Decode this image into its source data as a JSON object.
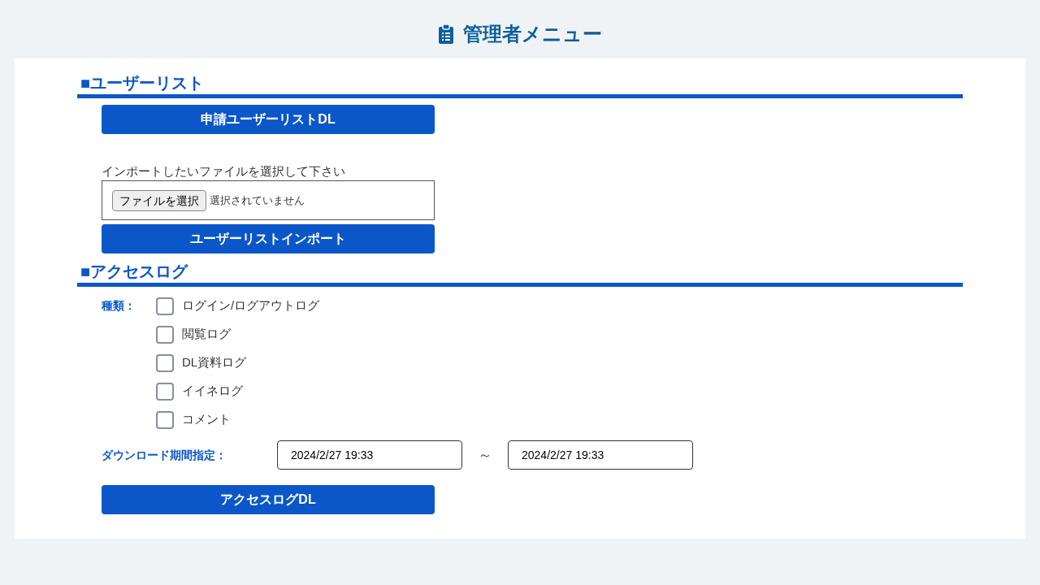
{
  "page": {
    "title": "管理者メニュー"
  },
  "user_list": {
    "heading": "■ユーザーリスト",
    "download_button": "申請ユーザーリストDL",
    "import_label": "インポートしたいファイルを選択して下さい",
    "file_picker": {
      "button": "ファイルを選択",
      "status": "選択されていません"
    },
    "import_button": "ユーザーリストインポート"
  },
  "access_log": {
    "heading": "■アクセスログ",
    "type_label": "種類：",
    "types": [
      {
        "label": "ログイン/ログアウトログ",
        "checked": false
      },
      {
        "label": "閲覧ログ",
        "checked": false
      },
      {
        "label": "DL資料ログ",
        "checked": false
      },
      {
        "label": "イイネログ",
        "checked": false
      },
      {
        "label": "コメント",
        "checked": false
      }
    ],
    "period_label": "ダウンロード期間指定：",
    "from": "2024/2/27 19:33",
    "separator": "～",
    "to": "2024/2/27 19:33",
    "download_button": "アクセスログDL"
  }
}
